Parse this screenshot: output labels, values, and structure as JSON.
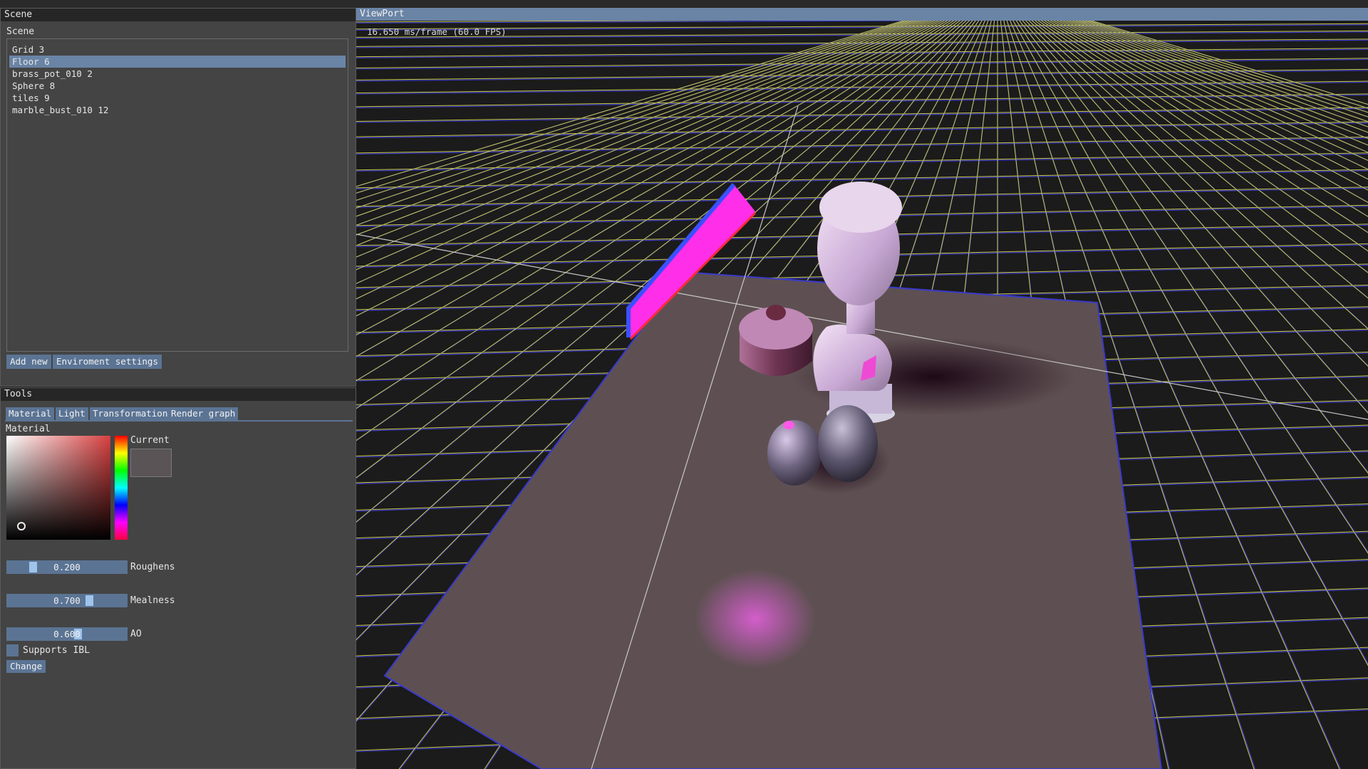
{
  "scene_panel": {
    "title": "Scene",
    "section_label": "Scene",
    "items": [
      {
        "label": "Grid 3",
        "selected": false
      },
      {
        "label": "Floor 6",
        "selected": true
      },
      {
        "label": "brass_pot_010 2",
        "selected": false
      },
      {
        "label": "Sphere 8",
        "selected": false
      },
      {
        "label": "tiles 9",
        "selected": false
      },
      {
        "label": "marble_bust_010 12",
        "selected": false
      }
    ],
    "add_new_label": "Add new",
    "environment_label": "Enviroment settings"
  },
  "tools_panel": {
    "title": "Tools",
    "tabs": [
      "Material",
      "Light",
      "Transformation",
      "Render graph"
    ],
    "active_tab": "Material",
    "section_label": "Material",
    "current_label": "Current",
    "current_color": "#5a5456",
    "sliders": [
      {
        "label": "Roughens",
        "value": "0.200",
        "fraction": 0.2
      },
      {
        "label": "Mealness",
        "value": "0.700",
        "fraction": 0.7
      },
      {
        "label": "AO",
        "value": "0.600",
        "fraction": 0.6
      }
    ],
    "ibl_label": "Supports IBL",
    "ibl_checked": false,
    "change_label": "Change"
  },
  "viewport": {
    "title": "ViewPort",
    "fps_text": "16.650 ms/frame (60.0 FPS)"
  },
  "colors": {
    "accent": "#5b7494",
    "selected": "#6a84a6",
    "panel": "#444444",
    "titlebar": "#262626",
    "viewport_bg": "#1b1b1b",
    "floor": "#5e5052",
    "grid_yellow": "#c8c84a",
    "grid_blue": "#3a3acc",
    "neon_magenta": "#ff2ee8"
  }
}
